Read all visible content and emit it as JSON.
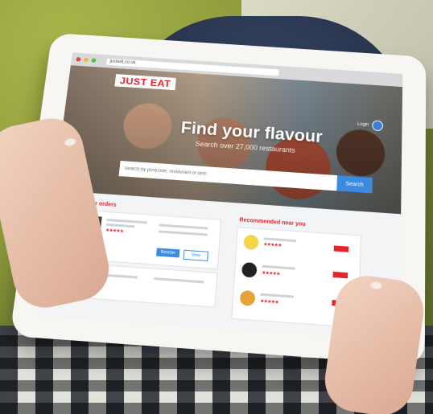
{
  "browser": {
    "url": "justeat.co.uk"
  },
  "site": {
    "logo": "JUST EAT",
    "login_label": "Login",
    "hero_title": "Find your flavour",
    "hero_subtitle": "Search over 27,000 restaurants",
    "search_placeholder": "Search by postcode, restaurant or dish",
    "search_button": "Search"
  },
  "sections": {
    "recent_orders": "Your orders",
    "recommended": "Recommended near you",
    "reorder_label": "Reorder",
    "details_label": "View"
  },
  "colors": {
    "brand": "#e3262b",
    "accent": "#3d8be0"
  }
}
